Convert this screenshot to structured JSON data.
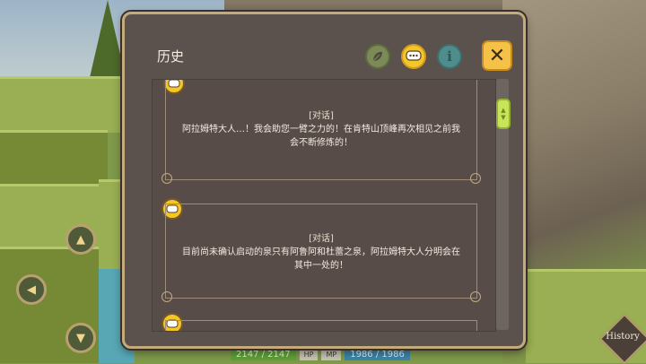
{
  "dialog": {
    "title": "历史",
    "close_glyph": "✕",
    "info_glyph": "i",
    "tabs": [
      {
        "icon": "leaf-icon"
      },
      {
        "icon": "chat-bubble-icon"
      },
      {
        "icon": "info-icon"
      }
    ]
  },
  "entries": [
    {
      "tag": "[对话]",
      "lines": [
        "阿拉姆特大人…！我会助您一臂之力的！在肯特山顶峰再次相见之前我",
        "会不断修炼的！"
      ]
    },
    {
      "tag": "[对话]",
      "lines": [
        "目前尚未确认启动的泉只有阿鲁阿和杜蕾之泉，阿拉姆特大人分明会在",
        "其中一处的！"
      ]
    }
  ],
  "status": {
    "hp_value": "2147 / 2147",
    "hp_label": "HP",
    "mp_label": "MP",
    "mp_value": "1986 / 1986"
  },
  "history_button": {
    "label": "History"
  },
  "colors": {
    "accent_gold": "#f3c72a",
    "panel": "#5c524d",
    "frame": "#c4ab7b",
    "scroll_thumb": "#c9e45a"
  }
}
